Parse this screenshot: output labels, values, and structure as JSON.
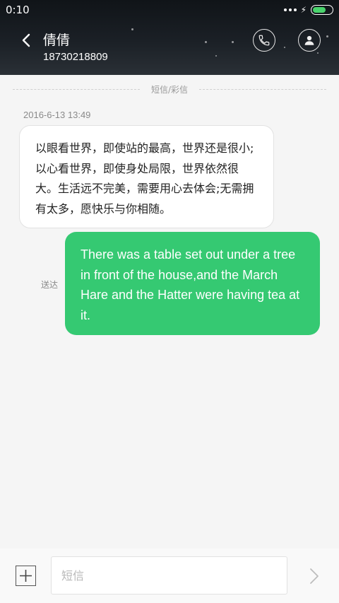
{
  "status_bar": {
    "time": "0:10",
    "battery_level": 0.6
  },
  "header": {
    "contact_name": "倩倩",
    "contact_number": "18730218809",
    "icons": [
      "back-icon",
      "phone-icon",
      "contact-icon"
    ]
  },
  "thread": {
    "divider_label": "短信/彩信",
    "timestamp": "2016-6-13 13:49",
    "messages": [
      {
        "direction": "incoming",
        "text": "以眼看世界，即使站的最高，世界还是很小;以心看世界，即使身处局限，世界依然很大。生活远不完美，需要用心去体会;无需拥有太多，愿快乐与你相随。"
      },
      {
        "direction": "outgoing",
        "status": "送达",
        "text": "There was a table set out under a tree in front of the house,and the March Hare and the Hatter were having tea at it."
      }
    ]
  },
  "composer": {
    "placeholder": "短信",
    "value": "",
    "icons": [
      "add-icon",
      "send-icon"
    ]
  },
  "colors": {
    "outgoing_bubble": "#35c972",
    "battery": "#49d36c"
  }
}
